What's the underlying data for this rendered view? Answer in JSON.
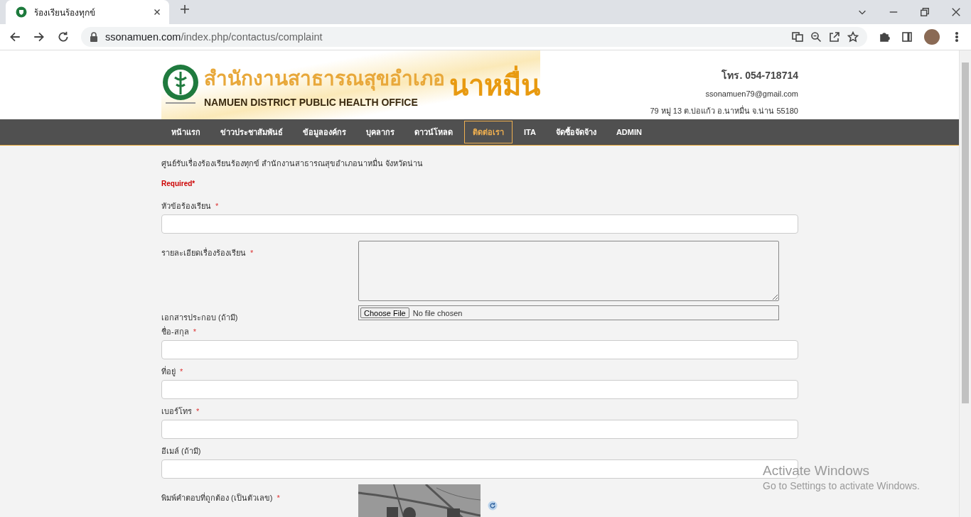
{
  "browser": {
    "tab": {
      "title": "ร้องเรียนร้องทุกข์",
      "selected": true
    },
    "address": {
      "domain": "ssonamuen.com",
      "path": "/index.php/contactus/complaint"
    }
  },
  "header": {
    "logo": {
      "thai": "สำนักงานสาธารณสุขอำเภอ",
      "english": "NAMUEN DISTRICT PUBLIC HEALTH OFFICE",
      "place": "นาหมื่น"
    },
    "phone": "โทร. 054-718714",
    "email": "ssonamuen79@gmail.com",
    "address": "79 หมู่ 13 ต.บ่อแก้ว อ.นาหมื่น จ.น่าน 55180"
  },
  "nav": [
    {
      "label": "หน้าแรก",
      "selected": false
    },
    {
      "label": "ข่าวประชาสัมพันธ์",
      "selected": false
    },
    {
      "label": "ข้อมูลองค์กร",
      "selected": false
    },
    {
      "label": "บุคลากร",
      "selected": false
    },
    {
      "label": "ดาวน์โหลด",
      "selected": false
    },
    {
      "label": "ติดต่อเรา",
      "selected": true
    },
    {
      "label": "ITA",
      "selected": false
    },
    {
      "label": "จัดซื้อจัดจ้าง",
      "selected": false
    },
    {
      "label": "ADMIN",
      "selected": false
    }
  ],
  "form": {
    "title": "ศูนย์รับเรื่องร้องเรียนร้องทุกข์ สำนักงานสาธารณสุขอำเภอนาหมื่น จังหวัดน่าน",
    "required_note": "Required*",
    "fields": [
      {
        "kind": "text",
        "label": "หัวข้อร้องเรียน",
        "required_mark": "*"
      },
      {
        "kind": "textarea",
        "label": "รายละเอียดเรื่องร้องเรียน",
        "required_mark": "*"
      },
      {
        "kind": "file",
        "label": "เอกสารประกอบ (ถ้ามี)",
        "button": "Choose File",
        "status": "No file chosen"
      },
      {
        "kind": "text",
        "label": "ชื่อ-สกุล",
        "required_mark": "*"
      },
      {
        "kind": "text",
        "label": "ที่อยู่",
        "required_mark": "*"
      },
      {
        "kind": "text",
        "label": "เบอร์โทร",
        "required_mark": "*"
      },
      {
        "kind": "text",
        "label": "อีเมล์ (ถ้ามี)"
      },
      {
        "kind": "captcha",
        "label": "พิมพ์คำตอบที่ถูกต้อง (เป็นตัวเลข)",
        "required_mark": "*"
      }
    ]
  },
  "os_notice": {
    "title": "Activate Windows",
    "text": "Go to Settings to activate Windows."
  }
}
